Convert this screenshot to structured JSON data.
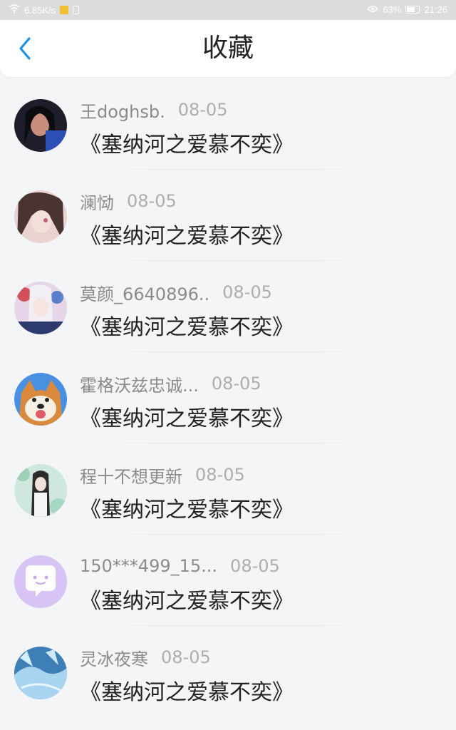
{
  "status_bar": {
    "net_speed": "6.85K/s",
    "battery_percent": "63%",
    "time": "21:26"
  },
  "header": {
    "title": "收藏"
  },
  "items": [
    {
      "name": "王doghsb.",
      "date": "08-05",
      "content": "《塞纳河之爱慕不奕》"
    },
    {
      "name": "澜恸",
      "date": "08-05",
      "content": "《塞纳河之爱慕不奕》"
    },
    {
      "name": "莫颜_6640896..",
      "date": "08-05",
      "content": "《塞纳河之爱慕不奕》"
    },
    {
      "name": "霍格沃兹忠诚...",
      "date": "08-05",
      "content": "《塞纳河之爱慕不奕》"
    },
    {
      "name": "程十不想更新",
      "date": "08-05",
      "content": "《塞纳河之爱慕不奕》"
    },
    {
      "name": "150***499_15...",
      "date": "08-05",
      "content": "《塞纳河之爱慕不奕》"
    },
    {
      "name": "灵冰夜寒",
      "date": "08-05",
      "content": "《塞纳河之爱慕不奕》"
    }
  ],
  "colors": {
    "accent": "#1e90e6",
    "name_text": "#8b8b8b",
    "date_text": "#aeaeae",
    "content_text": "#222222"
  }
}
